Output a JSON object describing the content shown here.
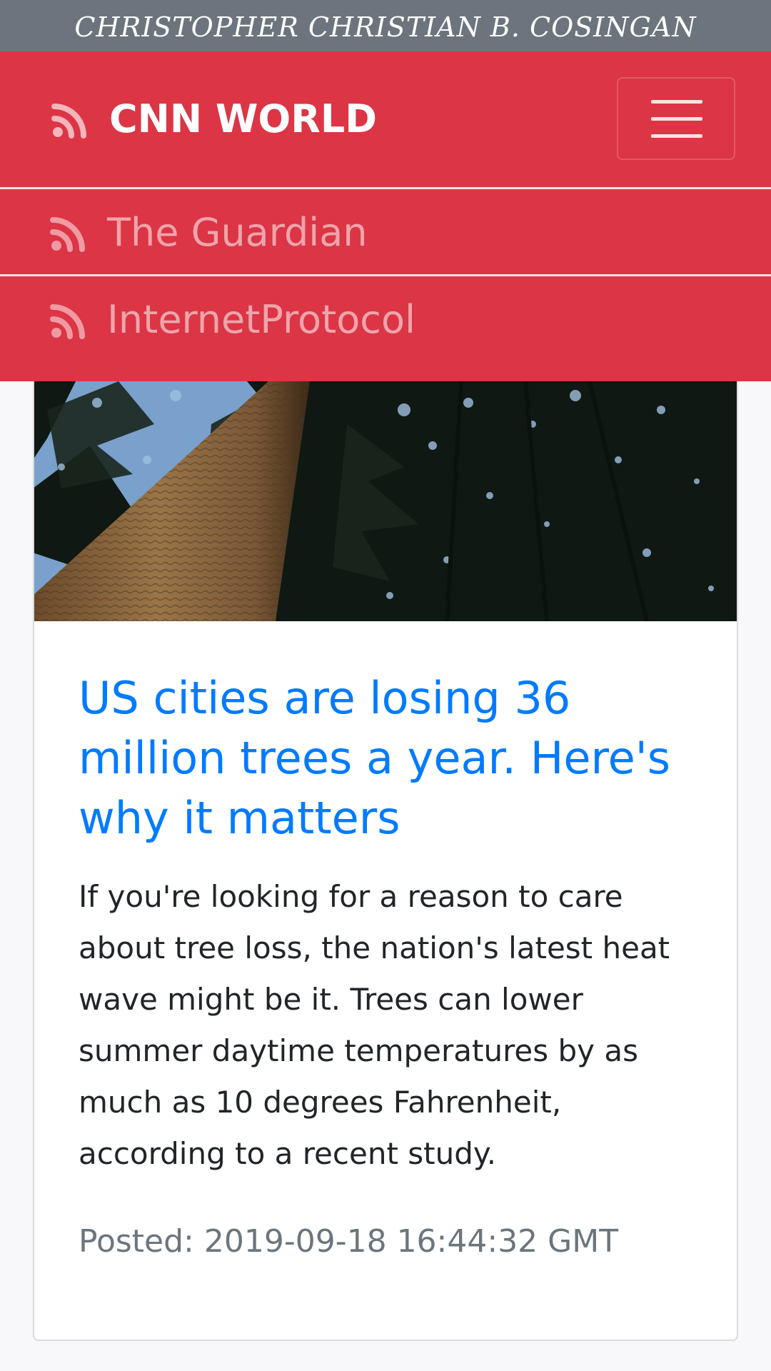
{
  "header": {
    "author": "CHRISTOPHER CHRISTIAN B. COSINGAN"
  },
  "navbar": {
    "brand": "CNN WORLD",
    "brand_icon": "rss-icon",
    "toggle_icon": "hamburger-menu-icon",
    "accent": "#dc3545",
    "items": [
      {
        "label": "The Guardian",
        "icon": "rss-icon"
      },
      {
        "label": "InternetProtocol",
        "icon": "rss-icon"
      }
    ]
  },
  "article": {
    "image": "forest-trees-looking-up",
    "title": "US cities are losing 36 million trees a year. Here's why it matters",
    "summary": "If you're looking for a reason to care about tree loss, the nation's latest heat wave might be it. Trees can lower summer daytime temperatures by as much as 10 degrees Fahrenheit, according to a recent study.",
    "posted": "Posted: 2019-09-18 16:44:32 GMT",
    "title_color": "#007bff"
  }
}
